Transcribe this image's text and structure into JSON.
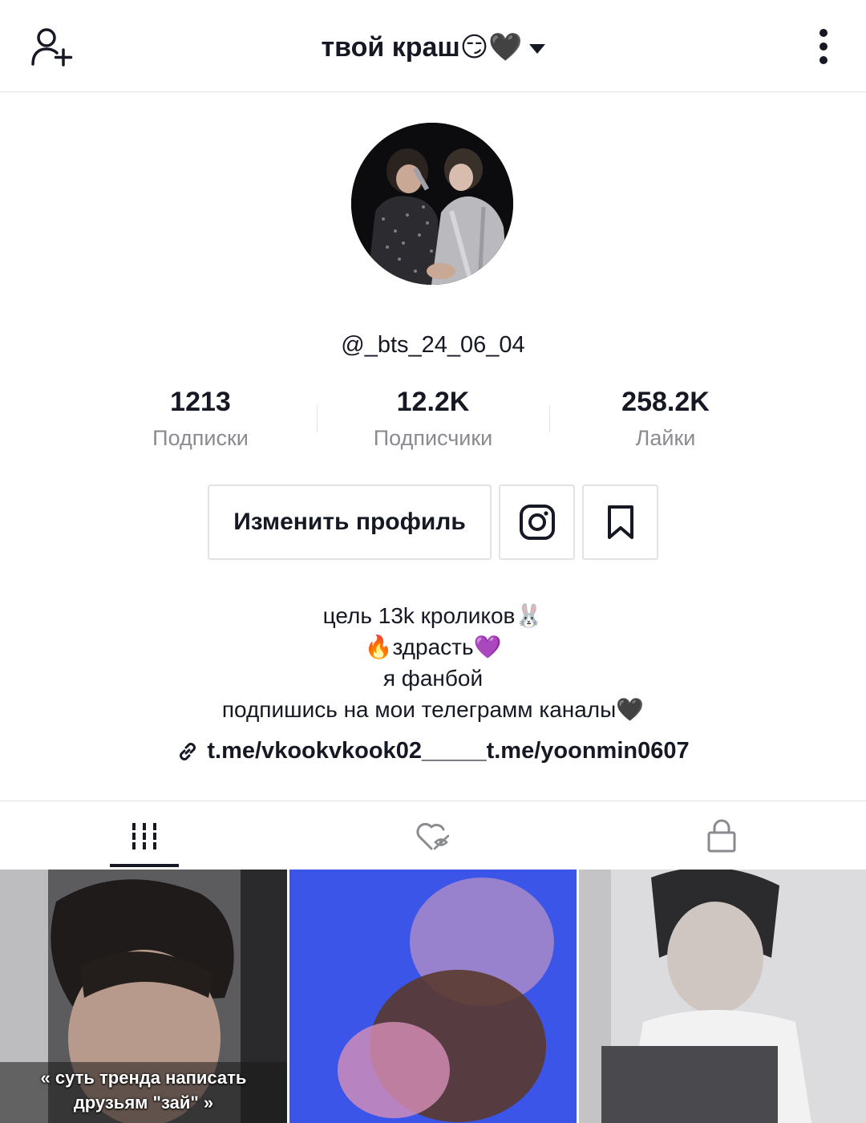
{
  "header": {
    "title": "твой краш😏🖤",
    "left_icon": "add-user-icon",
    "right_icon": "more-vertical-icon"
  },
  "profile": {
    "username": "@_bts_24_06_04",
    "stats": [
      {
        "value": "1213",
        "label": "Подписки"
      },
      {
        "value": "12.2K",
        "label": "Подписчики"
      },
      {
        "value": "258.2K",
        "label": "Лайки"
      }
    ],
    "edit_button": "Изменить профиль",
    "instagram_icon": "instagram-icon",
    "bookmark_icon": "bookmark-icon",
    "bio": [
      "цель 13k кроликов🐰",
      "🔥здрасть💜",
      "я фанбой",
      "подпишись на мои телеграмм каналы🖤"
    ],
    "link": "t.me/vkookvkook02_____t.me/yoonmin0607"
  },
  "tabs": [
    {
      "icon": "videos-grid-icon",
      "active": true
    },
    {
      "icon": "liked-hidden-icon",
      "active": false
    },
    {
      "icon": "lock-icon",
      "active": false
    }
  ],
  "videos": [
    {
      "caption_lines": [
        "« суть  тренда написать",
        "друзьям \"зай\" »"
      ]
    },
    {
      "caption_lines": []
    },
    {
      "caption_lines": []
    }
  ],
  "colors": {
    "text": "#161823",
    "muted": "#8a8b91",
    "border": "#e3e3e4",
    "tile_blue": "#3a55e8"
  }
}
